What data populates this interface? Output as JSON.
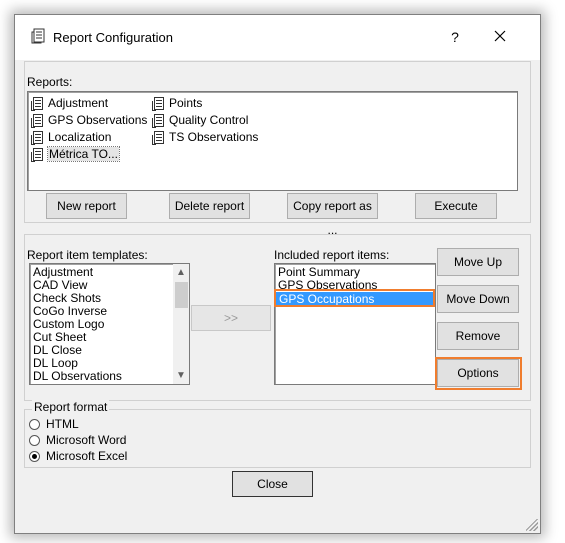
{
  "window": {
    "title": "Report Configuration",
    "help_label": "?",
    "close_label": "✕"
  },
  "reports": {
    "label": "Reports:",
    "items": [
      {
        "label": "Adjustment"
      },
      {
        "label": "GPS Observations"
      },
      {
        "label": "Localization"
      },
      {
        "label": "Métrica TO..."
      },
      {
        "label": "Points"
      },
      {
        "label": "Quality Control"
      },
      {
        "label": "TS Observations"
      }
    ],
    "selected": "Métrica TO...",
    "buttons": {
      "new": "New report",
      "delete": "Delete report",
      "copy": "Copy report as ...",
      "execute": "Execute"
    }
  },
  "templates": {
    "label": "Report item templates:",
    "items": [
      "Adjustment",
      "CAD View",
      "Check Shots",
      "CoGo Inverse",
      "Custom Logo",
      "Cut Sheet",
      "DL Close",
      "DL Loop",
      "DL Observations"
    ],
    "scroll_up": "▲",
    "scroll_down": "▼"
  },
  "add_button_label": ">>",
  "included": {
    "label": "Included report items:",
    "items": [
      "Point Summary",
      "GPS Observations",
      "GPS Occupations"
    ],
    "selected": "GPS Occupations"
  },
  "side_buttons": {
    "move_up": "Move Up",
    "move_down": "Move Down",
    "remove": "Remove",
    "options": "Options"
  },
  "format": {
    "label": "Report format",
    "options": [
      {
        "label": "HTML",
        "selected": false
      },
      {
        "label": "Microsoft Word",
        "selected": false
      },
      {
        "label": "Microsoft Excel",
        "selected": true
      }
    ]
  },
  "close_button": "Close",
  "highlight_color": "#f07d2e",
  "selection_color": "#3399ff"
}
